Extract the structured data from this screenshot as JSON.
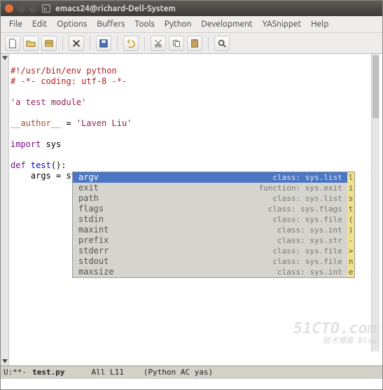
{
  "window": {
    "title": "emacs24@richard-Dell-System"
  },
  "menu": {
    "file": "File",
    "edit": "Edit",
    "options": "Options",
    "buffers": "Buffers",
    "tools": "Tools",
    "python": "Python",
    "development": "Development",
    "yasnippet": "YASnippet",
    "help": "Help"
  },
  "toolbar": {
    "new": "new-file",
    "open": "open",
    "dired": "dired",
    "close": "close",
    "save": "save",
    "undo": "undo",
    "cut": "cut",
    "copy": "copy",
    "paste": "paste",
    "search": "search"
  },
  "code": {
    "l1": "#!/usr/bin/env python",
    "l2": "# -*- coding: utf-8 -*-",
    "l3": "",
    "l4": "'a test module'",
    "l5": "",
    "l6a": "__author__",
    "l6b": " = ",
    "l6c": "'Laven Liu'",
    "l7": "",
    "l8a": "import",
    "l8b": " sys",
    "l9": "",
    "l10a": "def",
    "l10b": " ",
    "l10c": "test",
    "l10d": "():",
    "l11a": "    args = sys."
  },
  "completions": [
    {
      "name": "argv",
      "meta": "class: sys.list c"
    },
    {
      "name": "exit",
      "meta": "function: sys.exit f"
    },
    {
      "name": "path",
      "meta": "class: sys.list c"
    },
    {
      "name": "flags",
      "meta": "class: sys.flags c"
    },
    {
      "name": "stdin",
      "meta": "class: sys.file c"
    },
    {
      "name": "maxint",
      "meta": "class: sys.int c"
    },
    {
      "name": "prefix",
      "meta": "class: sys.str c"
    },
    {
      "name": "stderr",
      "meta": "class: sys.file c"
    },
    {
      "name": "stdout",
      "meta": "class: sys.file c"
    },
    {
      "name": "maxsize",
      "meta": "class: sys.int c"
    }
  ],
  "scroll_hint": "list()->new empty li",
  "modeline": {
    "status": "U:**-",
    "filename": "test.py",
    "position": "All L11",
    "modes": "(Python AC yas)"
  },
  "watermark": {
    "main": "51CTO.com",
    "sub": "技术博客  Blog"
  }
}
